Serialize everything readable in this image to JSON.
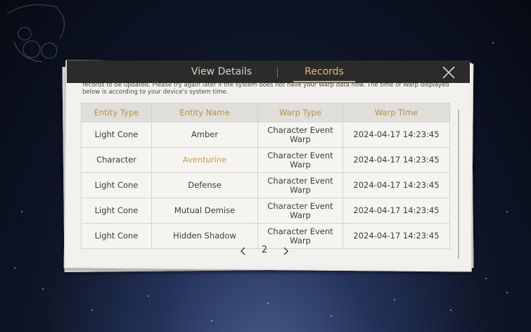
{
  "tabs": {
    "details_label": "View Details",
    "records_label": "Records",
    "active": "Records"
  },
  "notice": "records to be updated. Please try again later if the system does not have your Warp data now. The time of Warp displayed below is according to your device's system time.",
  "table": {
    "headers": [
      "Entity Type",
      "Entity Name",
      "Warp Type",
      "Warp Time"
    ],
    "rows": [
      {
        "type": "Light Cone",
        "name": "Amber",
        "warp_line1": "Character Event",
        "warp_line2": "Warp",
        "time": "2024-04-17 14:23:45"
      },
      {
        "type": "Character",
        "name": "Aventurine",
        "warp_line1": "Character Event",
        "warp_line2": "Warp",
        "time": "2024-04-17 14:23:45"
      },
      {
        "type": "Light Cone",
        "name": "Defense",
        "warp_line1": "Character Event",
        "warp_line2": "Warp",
        "time": "2024-04-17 14:23:45"
      },
      {
        "type": "Light Cone",
        "name": "Mutual Demise",
        "warp_line1": "Character Event",
        "warp_line2": "Warp",
        "time": "2024-04-17 14:23:45"
      },
      {
        "type": "Light Cone",
        "name": "Hidden Shadow",
        "warp_line1": "Character Event",
        "warp_line2": "Warp",
        "time": "2024-04-17 14:23:45"
      }
    ]
  },
  "pagination": {
    "page": "2",
    "prev_icon": "chevron-left-icon",
    "next_icon": "chevron-right-icon"
  },
  "icons": {
    "close": "close-icon"
  },
  "colors": {
    "accent_gold": "#d6ae66",
    "header_text": "#b4904c",
    "highlight_name": "#caa050",
    "tab_bar": "#2b2b2a"
  }
}
